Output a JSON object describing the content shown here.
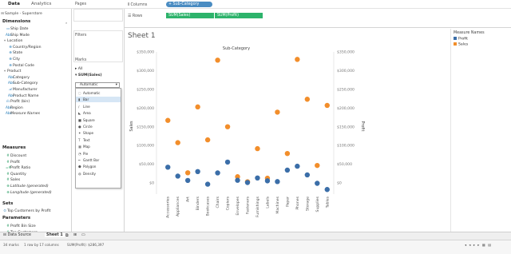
{
  "top": {
    "tabs": [
      "Data",
      "Analytics"
    ],
    "pages_label": "Pages",
    "columns_label": "Columns",
    "rows_label": "Rows"
  },
  "data_pane": {
    "datasource": "Sample - Superstore",
    "dimensions_header": "Dimensions",
    "dimensions": [
      {
        "label": "Ship Date",
        "kind": "dim",
        "glyph": "▭"
      },
      {
        "label": "Ship Mode",
        "kind": "dim",
        "glyph": "Abc"
      },
      {
        "label": "Location",
        "kind": "folder",
        "glyph": "▾"
      },
      {
        "label": "Country/Region",
        "kind": "geo",
        "glyph": "⊕"
      },
      {
        "label": "State",
        "kind": "geo",
        "glyph": "⊕"
      },
      {
        "label": "City",
        "kind": "geo",
        "glyph": "⊕"
      },
      {
        "label": "Postal Code",
        "kind": "geo",
        "glyph": "⊕"
      },
      {
        "label": "Product",
        "kind": "folder",
        "glyph": "▾"
      },
      {
        "label": "Category",
        "kind": "dim",
        "glyph": "Abc"
      },
      {
        "label": "Sub-Category",
        "kind": "dim",
        "glyph": "Abc"
      },
      {
        "label": "Manufacturer",
        "kind": "dim",
        "glyph": "𝓐"
      },
      {
        "label": "Product Name",
        "kind": "dim",
        "glyph": "Abc"
      },
      {
        "label": "Profit (bin)",
        "kind": "dim",
        "glyph": "ılı"
      },
      {
        "label": "Region",
        "kind": "dim",
        "glyph": "Abc"
      },
      {
        "label": "Measure Names",
        "kind": "dim-italic",
        "glyph": "Abc"
      }
    ],
    "measures_header": "Measures",
    "measures": [
      {
        "label": "Discount",
        "glyph": "#"
      },
      {
        "label": "Profit",
        "glyph": "#"
      },
      {
        "label": "Profit Ratio",
        "glyph": "=#"
      },
      {
        "label": "Quantity",
        "glyph": "#"
      },
      {
        "label": "Sales",
        "glyph": "#"
      },
      {
        "label": "Latitude (generated)",
        "glyph": "⊕"
      },
      {
        "label": "Longitude (generated)",
        "glyph": "⊕"
      }
    ],
    "sets_header": "Sets",
    "sets": [
      {
        "label": "Top Customers by Profit",
        "glyph": "⊙"
      }
    ],
    "parameters_header": "Parameters",
    "parameters": [
      {
        "label": "Profit Bin Size",
        "glyph": "#"
      },
      {
        "label": "Top Customers",
        "glyph": "#"
      }
    ]
  },
  "cards": {
    "filters_label": "Filters",
    "marks_label": "Marks",
    "all_label": "All",
    "measure_label": "SUM(Sales)",
    "dropdown_value": "Automatic",
    "mark_types": [
      "Automatic",
      "Bar",
      "Line",
      "Area",
      "Square",
      "Circle",
      "Shape",
      "Text",
      "Map",
      "Pie",
      "Gantt Bar",
      "Polygon",
      "Density"
    ],
    "selected_mark": "Bar"
  },
  "shelves": {
    "columns_pill": "Sub-Category",
    "rows_pills": [
      "SUM(Sales)",
      "SUM(Profit)"
    ]
  },
  "sheet": {
    "title": "Sheet 1"
  },
  "legend": {
    "title": "Measure Names",
    "items": [
      {
        "label": "Profit",
        "color": "#3b6ea8"
      },
      {
        "label": "Sales",
        "color": "#f28e2b"
      }
    ]
  },
  "chart_data": {
    "type": "scatter",
    "title": "Sub-Category",
    "categories": [
      "Accessories",
      "Appliances",
      "Art",
      "Binders",
      "Bookcases",
      "Chairs",
      "Copiers",
      "Envelopes",
      "Fasteners",
      "Furnishings",
      "Labels",
      "Machines",
      "Paper",
      "Phones",
      "Storage",
      "Supplies",
      "Tables"
    ],
    "series": [
      {
        "name": "Sales",
        "color": "#f28e2b",
        "axis": "left",
        "values": [
          167000,
          107500,
          27000,
          203000,
          115000,
          328000,
          150000,
          16500,
          3000,
          91500,
          12500,
          189000,
          78500,
          330000,
          223500,
          46500,
          207000
        ]
      },
      {
        "name": "Profit",
        "color": "#3b6ea8",
        "axis": "right",
        "values": [
          41900,
          18100,
          6500,
          30200,
          -3500,
          26600,
          55600,
          6900,
          950,
          13100,
          5500,
          3400,
          34100,
          44500,
          21300,
          -1200,
          -17700
        ]
      }
    ],
    "ylabel_left": "Sales",
    "ylabel_right": "Profit",
    "y_ticks": [
      "$0",
      "$50,000",
      "$100,000",
      "$150,000",
      "$200,000",
      "$250,000",
      "$300,000",
      "$350,000"
    ],
    "ylim_left": [
      -30000,
      350000
    ],
    "ylim_right": [
      -30000,
      350000
    ]
  },
  "tabbar": {
    "data_source": "Data Source",
    "sheet": "Sheet 1"
  },
  "status": {
    "marks": "34 marks",
    "dims": "1 row by 17 columns",
    "sum": "SUM(Profit): $286,397"
  }
}
